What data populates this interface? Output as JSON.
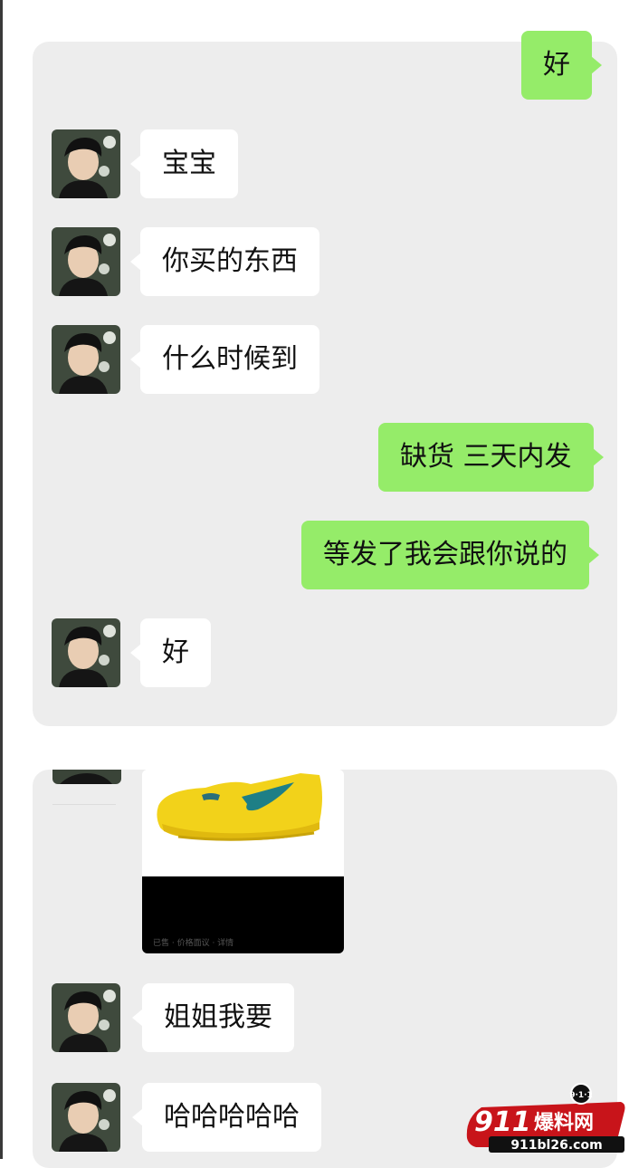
{
  "colors": {
    "sent_bubble": "#95ec69",
    "received_bubble": "#ffffff",
    "panel": "#ededed"
  },
  "messages": [
    {
      "dir": "sent",
      "text": "好"
    },
    {
      "dir": "recv",
      "text": "宝宝",
      "avatar": "user-avatar"
    },
    {
      "dir": "recv",
      "text": "你买的东西",
      "avatar": "user-avatar"
    },
    {
      "dir": "recv",
      "text": "什么时候到",
      "avatar": "user-avatar"
    },
    {
      "dir": "sent",
      "text": "缺货 三天内发"
    },
    {
      "dir": "sent",
      "text": "等发了我会跟你说的"
    },
    {
      "dir": "recv",
      "text": "好",
      "avatar": "user-avatar"
    },
    {
      "dir": "recv",
      "text": "姐姐我要",
      "avatar": "user-avatar"
    },
    {
      "dir": "recv",
      "text": "哈哈哈哈哈",
      "avatar": "user-avatar"
    }
  ],
  "image_message": {
    "content": "yellow-sneaker-photo",
    "caption": "已售 · 价格面议 · 详情"
  },
  "watermark": {
    "badge": "9·1·1",
    "number": "911",
    "title": "爆料网",
    "url": "911bl26.com"
  }
}
